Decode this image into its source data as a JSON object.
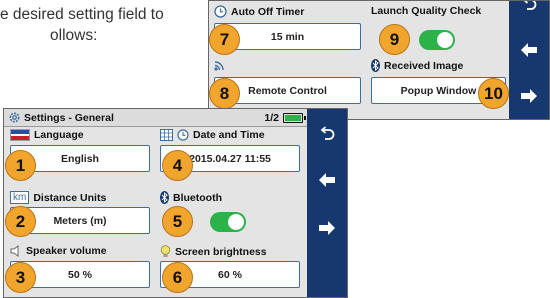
{
  "intro": {
    "line1": "e desired setting field to",
    "line2": "ollows:"
  },
  "back_screen": {
    "auto_off_timer": {
      "label": "Auto Off Timer",
      "value": "15 min",
      "callout": "7",
      "icon": "clock-icon"
    },
    "launch_quality_check": {
      "label": "Launch Quality Check",
      "state": "on",
      "callout": "9"
    },
    "remote": {
      "icon": "wifi-signal-icon",
      "value": "Remote Control",
      "callout": "8"
    },
    "received_image": {
      "label": "Received Image",
      "value": "Popup Window",
      "callout": "10",
      "icon": "bluetooth-icon"
    },
    "nav": [
      "back-arrow-icon",
      "left-arrow-icon",
      "right-arrow-icon"
    ]
  },
  "front_screen": {
    "title": "Settings - General",
    "page_indicator": "1/2",
    "battery_level": 1.0,
    "language": {
      "label": "Language",
      "value": "English",
      "callout": "1",
      "icon": "flag-icon"
    },
    "date_time": {
      "label": "Date and Time",
      "value": "2015.04.27 11:55",
      "callout": "4",
      "icon": "calendar-clock-icon"
    },
    "distance_units": {
      "label": "Distance Units",
      "value": "Meters (m)",
      "callout": "2",
      "badge": "km"
    },
    "bluetooth": {
      "label": "Bluetooth",
      "state": "on",
      "callout": "5",
      "icon": "bluetooth-icon"
    },
    "speaker_volume": {
      "label": "Speaker volume",
      "value": "50 %",
      "callout": "3",
      "icon": "speaker-icon"
    },
    "screen_brightness": {
      "label": "Screen brightness",
      "value": "60 %",
      "callout": "6",
      "icon": "bulb-icon"
    }
  },
  "colors": {
    "navbar": "#17386e",
    "field_border": "#3e6ea0",
    "toggle_on": "#2bb34a",
    "callout": "#f2a52c",
    "screen_bg": "#e4e4e4"
  }
}
